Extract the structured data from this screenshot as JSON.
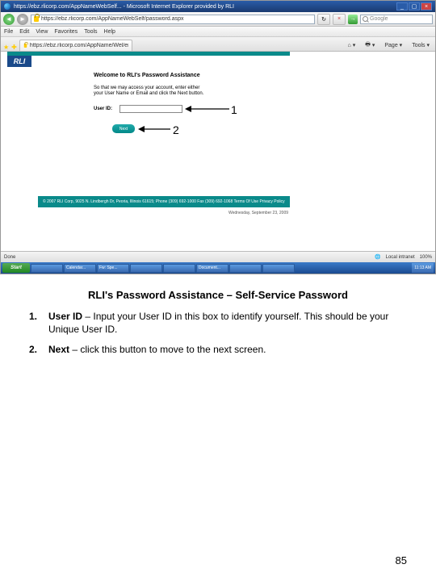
{
  "titlebar": {
    "title": "https://ebz.rlicorp.com/AppNameWebSelf... - Microsoft Internet Explorer provided by RLI"
  },
  "addressbar": {
    "url": "https://ebz.rlicorp.com/AppNameWebSelf/password.aspx"
  },
  "menus": {
    "file": "File",
    "edit": "Edit",
    "view": "View",
    "favorites": "Favorites",
    "tools": "Tools",
    "help": "Help"
  },
  "tab": {
    "label": "https://ebz.rlicorp.com/AppName/Wel/en/Pas..."
  },
  "toolbar": {
    "home": "▾",
    "print": "▾",
    "page": "Page ▾",
    "tools": "Tools ▾"
  },
  "page": {
    "logo": "RLI",
    "heading": "Welcome to RLI's Password Assistance",
    "intro": "So that we may access your account, enter either your User Name or Email and click the Next button.",
    "userid_label": "User ID:",
    "next": "Next",
    "footer": "© 2007 RLI Corp, 9025 N. Lindbergh Dr, Peoria, Illinois 61615; Phone (309) 692-1000 Fax (309) 692-1068  Terms Of Use  Privacy Policy",
    "date": "Wednesday, September 23, 2009"
  },
  "callouts": {
    "n1": "1",
    "n2": "2"
  },
  "status": {
    "done": "Done",
    "zone": "Local intranet",
    "zoom": "100%"
  },
  "taskbar": {
    "start": "Start",
    "items": [
      "",
      "Calendar...",
      "Fw: Spe...",
      "",
      "",
      "Document...",
      "",
      ""
    ],
    "time": "11:13 AM"
  },
  "doc": {
    "heading": "RLI's Password Assistance – Self-Service Password",
    "items": [
      {
        "n": "1.",
        "bold": "User ID",
        "rest": " – Input your User ID in this box to identify yourself.  This should be your Unique User ID."
      },
      {
        "n": "2.",
        "bold": "Next",
        "rest": " – click this button to move to the next screen."
      }
    ],
    "pagenum": "85"
  }
}
